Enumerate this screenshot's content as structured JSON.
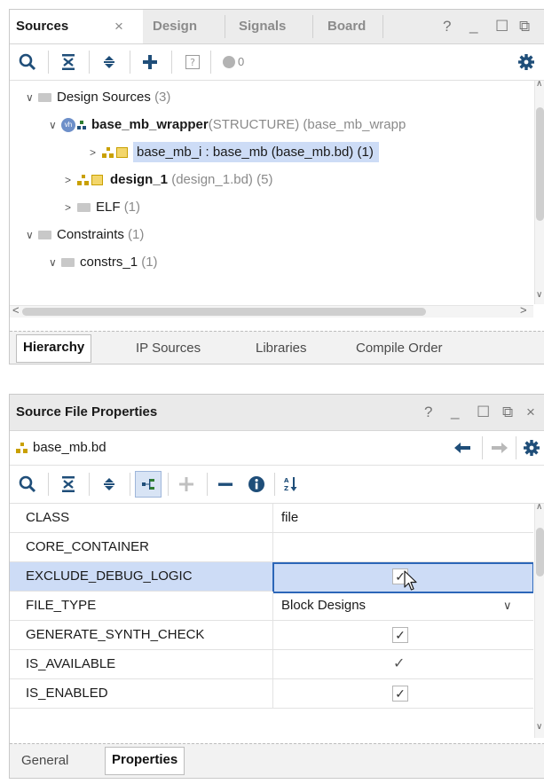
{
  "sources_panel": {
    "tabs": [
      "Sources",
      "Design",
      "Signals",
      "Board"
    ],
    "close_glyph": "×",
    "window_controls": [
      "?",
      "_",
      "☐",
      "⧉"
    ],
    "badge_count": "0",
    "tree": [
      {
        "label": "Design Sources",
        "count": "(3)"
      },
      {
        "badge": "vh",
        "name": "base_mb_wrapper",
        "suffix": "(STRUCTURE)",
        "extra": "(base_mb_wrapp"
      },
      {
        "name": "base_mb_i : base_mb (base_mb.bd)",
        "count": "(1)"
      },
      {
        "name": "design_1",
        "extra": "(design_1.bd)",
        "count": "(5)"
      },
      {
        "label": "ELF",
        "count": "(1)"
      },
      {
        "label": "Constraints",
        "count": "(1)"
      },
      {
        "label": "constrs_1",
        "count": "(1)"
      }
    ],
    "bottom_tabs": [
      "Hierarchy",
      "IP Sources",
      "Libraries",
      "Compile Order"
    ]
  },
  "properties_panel": {
    "title": "Source File Properties",
    "window_controls": [
      "?",
      "_",
      "☐",
      "⧉",
      "×"
    ],
    "file_name": "base_mb.bd",
    "properties": [
      {
        "name": "CLASS",
        "value": "file"
      },
      {
        "name": "CORE_CONTAINER",
        "value": ""
      },
      {
        "name": "EXCLUDE_DEBUG_LOGIC",
        "checked": true
      },
      {
        "name": "FILE_TYPE",
        "value": "Block Designs"
      },
      {
        "name": "GENERATE_SYNTH_CHECK",
        "checked": true
      },
      {
        "name": "IS_AVAILABLE",
        "checked": true
      },
      {
        "name": "IS_ENABLED",
        "checked": true
      }
    ],
    "bottom_tabs": [
      "General",
      "Properties"
    ]
  },
  "colors": {
    "selection": "#cddcf6",
    "selection_border": "#2c66b8",
    "icon_blue": "#1f4e79"
  }
}
